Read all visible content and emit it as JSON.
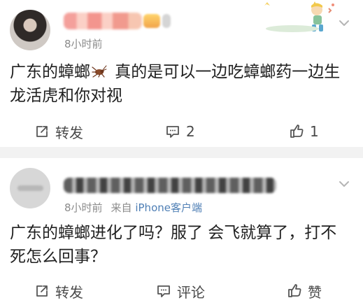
{
  "posts": [
    {
      "time": "8小时前",
      "text": {
        "before_emoji": "广东的蟑螂",
        "after_emoji": " 真的是可以一边吃蟑螂药一边生龙活虎和你对视"
      },
      "actions": {
        "share": "转发",
        "comment": "2",
        "like": "1"
      },
      "icons": {
        "inline": "cockroach-icon",
        "share": "share-icon",
        "comment": "comment-icon",
        "like": "thumbs-up-icon",
        "more": "chevron-down-icon"
      }
    },
    {
      "time": "8小时前",
      "source_prefix": "来自",
      "source_name": "iPhone客户端",
      "text": "广东的蟑螂进化了吗？服了 会飞就算了，打不死怎么回事？",
      "actions": {
        "share": "转发",
        "comment": "评论",
        "like": "赞"
      },
      "icons": {
        "share": "share-icon",
        "comment": "comment-icon",
        "like": "thumbs-up-icon",
        "more": "chevron-down-icon"
      }
    }
  ],
  "colors": {
    "separator": "#f2f2f2",
    "meta": "#8b8b8b",
    "link": "#4f7fb5"
  }
}
